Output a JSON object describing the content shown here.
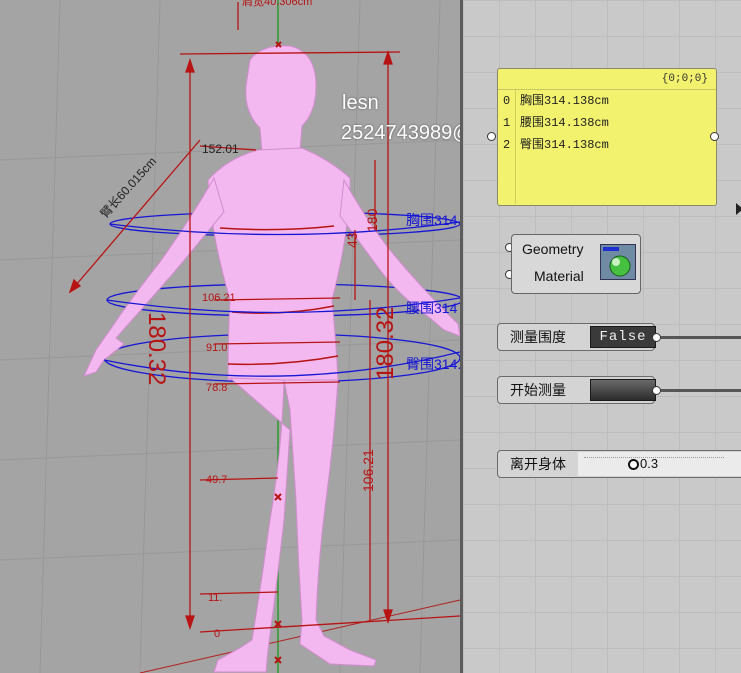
{
  "viewport": {
    "watermark_line1": "lesn",
    "watermark_line2": "2524743989@",
    "dims": {
      "top_partial": "肩宽40.306cm",
      "shoulder": "152.01",
      "arm_length": "臂长60.015cm",
      "height_left": "180.32",
      "height_right": "180.32",
      "v_43": "43",
      "v_180": "180",
      "v_106_21": "106.21",
      "v_49_7": "49.7",
      "v_11": "11.",
      "v_0": "0",
      "waist_small": "106.21",
      "hip_small": "91.0",
      "hip_small2": "78.8"
    },
    "tags": {
      "chest": "胸围314",
      "waist": "腰围314",
      "hip": "臀围314."
    }
  },
  "panel": {
    "header": "{0;0;0}",
    "rows": [
      {
        "index": "0",
        "value": "胸围314.138cm"
      },
      {
        "index": "1",
        "value": "腰围314.138cm"
      },
      {
        "index": "2",
        "value": "臀围314.138cm"
      }
    ]
  },
  "component": {
    "input1": "Geometry",
    "input2": "Material"
  },
  "controls": {
    "measure_label": "测量围度",
    "measure_value": "False",
    "start_label": "开始测量",
    "offset_label": "离开身体",
    "offset_value": "0.3"
  },
  "colors": {
    "body": "#f2b8ef",
    "dimension": "#b81313",
    "circle": "#1616d6",
    "panel": "#f2f26e"
  }
}
